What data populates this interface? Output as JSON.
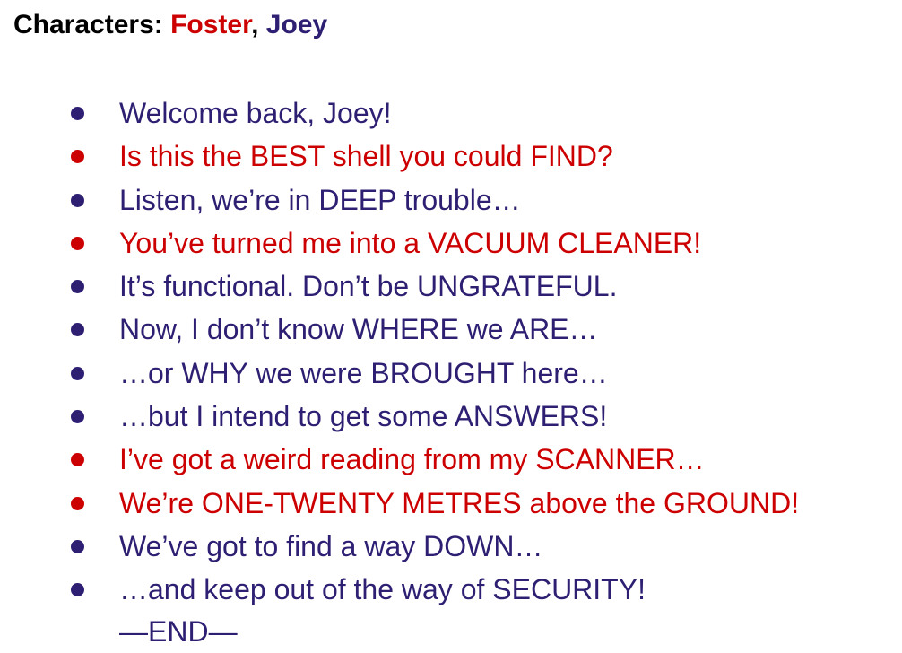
{
  "header": {
    "label": "Characters: ",
    "character_1": "Foster",
    "separator": ", ",
    "character_2": "Joey"
  },
  "colors": {
    "Joey": "#2e1f73",
    "Foster": "#cc0000",
    "label": "#000000"
  },
  "dialog": [
    {
      "speaker": "Joey",
      "text": "Welcome back, Joey!"
    },
    {
      "speaker": "Foster",
      "text": "Is this the BEST shell you could FIND?"
    },
    {
      "speaker": "Joey",
      "text": "Listen, we’re in DEEP trouble…"
    },
    {
      "speaker": "Foster",
      "text": "You’ve turned me into a VACUUM CLEANER!"
    },
    {
      "speaker": "Joey",
      "text": "It’s functional. Don’t be UNGRATEFUL."
    },
    {
      "speaker": "Joey",
      "text": "Now, I don’t know WHERE we ARE…"
    },
    {
      "speaker": "Joey",
      "text": "…or WHY we were BROUGHT here…"
    },
    {
      "speaker": "Joey",
      "text": "…but I intend to get some ANSWERS!"
    },
    {
      "speaker": "Foster",
      "text": "I’ve got a weird reading from my SCANNER…"
    },
    {
      "speaker": "Foster",
      "text": "We’re ONE-TWENTY METRES above the GROUND!"
    },
    {
      "speaker": "Joey",
      "text": "We’ve got to find a way DOWN…"
    },
    {
      "speaker": "Joey",
      "text": "…and keep out of the way of SECURITY!"
    }
  ],
  "end_marker": "—END—"
}
